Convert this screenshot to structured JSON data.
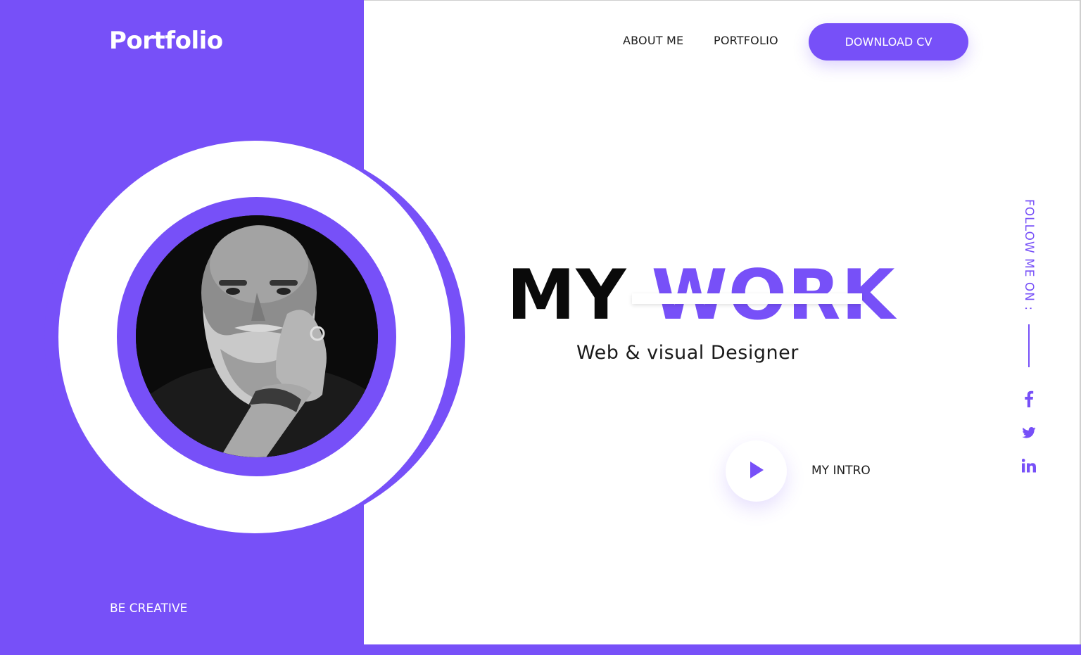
{
  "brand": {
    "logo": "Portfolio",
    "tagline": "BE CREATIVE"
  },
  "nav": {
    "items": [
      {
        "label": "ABOUT ME"
      },
      {
        "label": "PORTFOLIO"
      }
    ],
    "cta_label": "DOWNLOAD CV"
  },
  "hero": {
    "title_word1": "MY",
    "title_word2": "WORK",
    "subtitle": "Web & visual Designer"
  },
  "intro": {
    "label": "MY INTRO",
    "icon": "play-icon"
  },
  "social": {
    "label": "FOLLOW ME ON :",
    "icons": [
      "facebook-icon",
      "twitter-icon",
      "linkedin-icon"
    ]
  },
  "colors": {
    "accent": "#7750F8",
    "text": "#1d1d1d",
    "background": "#ffffff"
  }
}
